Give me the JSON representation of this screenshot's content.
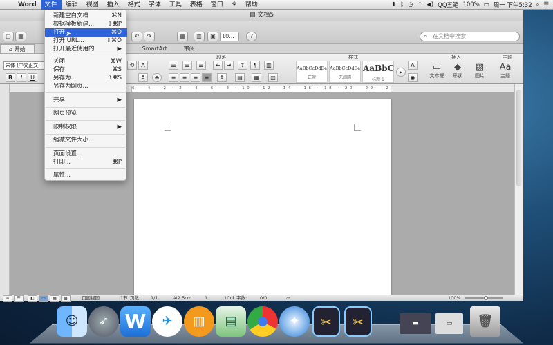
{
  "menubar": {
    "app": "Word",
    "items": [
      "文件",
      "编辑",
      "视图",
      "插入",
      "格式",
      "字体",
      "工具",
      "表格",
      "窗口",
      "帮助"
    ],
    "active_index": 0,
    "status": {
      "input_method": "QQ五笔",
      "battery": "100%",
      "clock": "周一 下午5:32"
    }
  },
  "window": {
    "title": "文档5",
    "zoom_value": "10...",
    "search_placeholder": "在文档中搜索"
  },
  "ribbon": {
    "tabs": [
      "开始",
      "",
      "",
      "",
      "SmartArt",
      "审阅"
    ],
    "active_tab": 0,
    "groups": {
      "paragraph": "段落",
      "styles": "样式",
      "insert": "插入",
      "themes": "主题"
    },
    "font_name": "宋体 (中文正文)",
    "styles": [
      {
        "sample": "AaBbCcDdEe",
        "name": "正常"
      },
      {
        "sample": "AaBbCcDdEe",
        "name": "无间隔"
      },
      {
        "sample": "AaBbC",
        "name": "标题 1"
      }
    ],
    "insert_buttons": [
      "文本框",
      "形状",
      "图片"
    ],
    "theme_button": "主题",
    "format_buttons": {
      "bold": "B",
      "italic": "I",
      "underline": "U"
    }
  },
  "ruler": {
    "ticks": "6 · 4 · 2 · 2 · 4 · 6 · 8 · 10 · 12 · 14 · 16 · 18 · 20 · 22 · 24 · 26 · 28 · 30 · 32 · 34 · 36 · 38 · 40 · 42"
  },
  "file_menu": {
    "items": [
      {
        "label": "新建空白文档",
        "shortcut": "⌘N"
      },
      {
        "label": "根据模板新建...",
        "shortcut": "⇧⌘P"
      },
      {
        "label": "打开...",
        "shortcut": "⌘O",
        "highlighted": true
      },
      {
        "label": "打开 URL...",
        "shortcut": "⇧⌘O"
      },
      {
        "label": "打开最近使用的",
        "shortcut": "▶"
      },
      {
        "label": "关闭",
        "shortcut": "⌘W"
      },
      {
        "label": "保存",
        "shortcut": "⌘S"
      },
      {
        "label": "另存为...",
        "shortcut": "⇧⌘S"
      },
      {
        "label": "另存为网页...",
        "shortcut": ""
      },
      {
        "label": "共享",
        "shortcut": "▶"
      },
      {
        "label": "网页预览",
        "shortcut": ""
      },
      {
        "label": "限制权限",
        "shortcut": "▶"
      },
      {
        "label": "缩减文件大小...",
        "shortcut": ""
      },
      {
        "label": "页面设置...",
        "shortcut": ""
      },
      {
        "label": "打印...",
        "shortcut": "⌘P"
      },
      {
        "label": "属性...",
        "shortcut": ""
      }
    ]
  },
  "statusbar": {
    "view_label": "页面视图",
    "section": "1节",
    "pages_label": "页数:",
    "pages": "1/1",
    "at": "At2.5cm",
    "line": "1",
    "col": "1Col",
    "words_label": "字数:",
    "words": "0/0",
    "zoom": "100%"
  },
  "dock": {
    "apps": [
      "finder",
      "launchpad",
      "wps",
      "feishu",
      "ibooks",
      "reader",
      "chrome",
      "safari",
      "screenshot-1",
      "screenshot-2",
      "doc-thumbnail",
      "trash"
    ]
  }
}
